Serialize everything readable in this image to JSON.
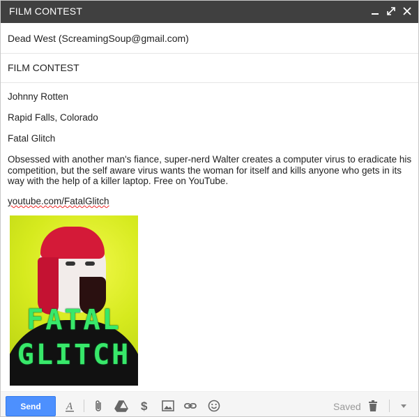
{
  "window": {
    "title": "FILM CONTEST"
  },
  "compose": {
    "to": "Dead West (ScreamingSoup@gmail.com)",
    "subject": "FILM CONTEST",
    "body": {
      "name": "Johnny Rotten",
      "location": "Rapid Falls, Colorado",
      "film_title": "Fatal Glitch",
      "synopsis": "Obsessed with another man's fiance, super-nerd Walter creates a computer virus to eradicate his competition, but the self aware virus wants the woman for itself and kills anyone who gets in its way with the help of a killer laptop. Free on YouTube.",
      "link": "youtube.com/FatalGlitch"
    },
    "poster": {
      "line1": "FATAL",
      "line2": "GLITCH"
    }
  },
  "toolbar": {
    "send_label": "Send",
    "saved_label": "Saved"
  },
  "colors": {
    "titlebar": "#404040",
    "send": "#4d90fe",
    "poster_bg": "#c8e014",
    "poster_text": "#38e86a"
  }
}
